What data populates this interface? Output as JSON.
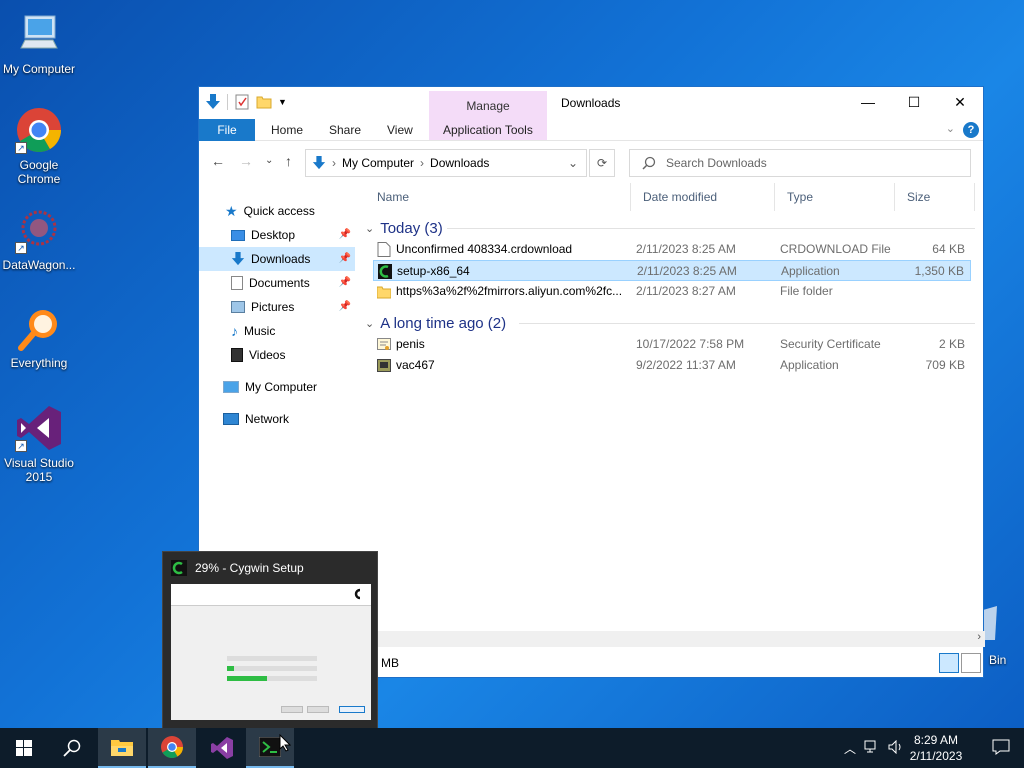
{
  "desktop": {
    "icons": [
      {
        "label": "My Computer"
      },
      {
        "label": "Google Chrome"
      },
      {
        "label": "DataWagon..."
      },
      {
        "label": "Everything"
      },
      {
        "label": "Visual Studio 2015"
      }
    ],
    "recycle_bin_label": "Bin"
  },
  "explorer": {
    "manage_label": "Manage",
    "title": "Downloads",
    "ribbon_tabs": [
      "File",
      "Home",
      "Share",
      "View",
      "Application Tools"
    ],
    "breadcrumb": [
      "My Computer",
      "Downloads"
    ],
    "search_placeholder": "Search Downloads",
    "nav": [
      {
        "label": "Quick access"
      },
      {
        "label": "Desktop"
      },
      {
        "label": "Downloads"
      },
      {
        "label": "Documents"
      },
      {
        "label": "Pictures"
      },
      {
        "label": "Music"
      },
      {
        "label": "Videos"
      },
      {
        "label": "My Computer"
      },
      {
        "label": "Network"
      }
    ],
    "columns": [
      "Name",
      "Date modified",
      "Type",
      "Size"
    ],
    "groups": [
      {
        "label": "Today (3)",
        "rows": [
          {
            "name": "Unconfirmed 408334.crdownload",
            "date": "2/11/2023 8:25 AM",
            "type": "CRDOWNLOAD File",
            "size": "64 KB"
          },
          {
            "name": "setup-x86_64",
            "date": "2/11/2023 8:25 AM",
            "type": "Application",
            "size": "1,350 KB"
          },
          {
            "name": "https%3a%2f%2fmirrors.aliyun.com%2fc...",
            "date": "2/11/2023 8:27 AM",
            "type": "File folder",
            "size": ""
          }
        ]
      },
      {
        "label": "A long time ago (2)",
        "rows": [
          {
            "name": "penis",
            "date": "10/17/2022 7:58 PM",
            "type": "Security Certificate",
            "size": "2 KB"
          },
          {
            "name": "vac467",
            "date": "9/2/2022 11:37 AM",
            "type": "Application",
            "size": "709 KB"
          }
        ]
      }
    ],
    "status_text": "MB"
  },
  "thumbnail": {
    "title": "29% - Cygwin Setup"
  },
  "taskbar": {
    "time": "8:29 AM",
    "date": "2/11/2023"
  },
  "colors": {
    "accent": "#1979ca",
    "selection": "#cce8ff",
    "group_header": "#1e3287"
  }
}
